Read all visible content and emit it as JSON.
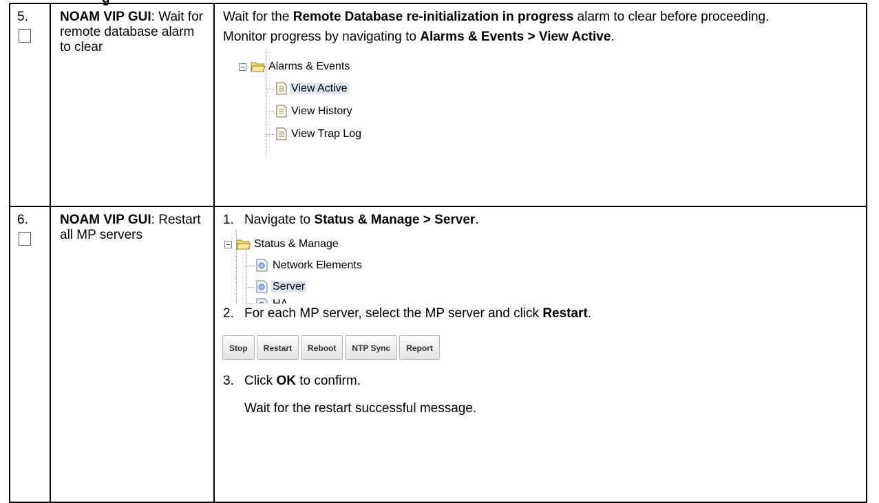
{
  "heading_fragment": "g",
  "steps": [
    {
      "number": "5.",
      "title_bold": "NOAM VIP GUI",
      "title_rest": ": Wait for remote database alarm to clear",
      "p1_a": "Wait for the ",
      "p1_b": "Remote Database re-initialization in progress",
      "p1_c": " alarm to clear before proceeding.",
      "p2_a": "Monitor progress by navigating to ",
      "p2_b": "Alarms & Events > View Active",
      "p2_c": ".",
      "tree": {
        "root": "Alarms & Events",
        "items": [
          "View Active",
          "View History",
          "View Trap Log"
        ],
        "selected": "View Active"
      }
    },
    {
      "number": "6.",
      "title_bold": "NOAM VIP GUI",
      "title_rest": ": Restart all MP servers",
      "s1_num": "1.",
      "s1_a": "Navigate to ",
      "s1_b": "Status & Manage > Server",
      "s1_c": ".",
      "tree": {
        "root": "Status & Manage",
        "items": [
          "Network Elements",
          "Server",
          "HA"
        ],
        "selected": "Server"
      },
      "s2_num": "2.",
      "s2_a": "For each MP server, select the MP server and click ",
      "s2_b": "Restart",
      "s2_c": ".",
      "buttons": [
        "Stop",
        "Restart",
        "Reboot",
        "NTP Sync",
        "Report"
      ],
      "s3_num": "3.",
      "s3_a": "Click ",
      "s3_b": "OK",
      "s3_c": " to confirm.",
      "s3_note": "Wait for the restart successful message."
    }
  ]
}
